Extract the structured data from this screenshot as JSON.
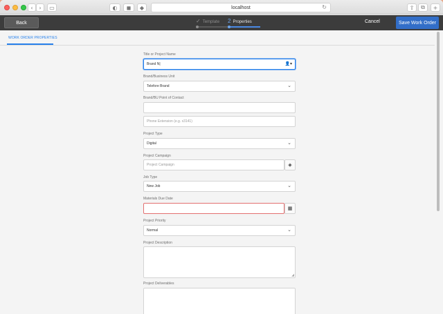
{
  "browser": {
    "url": "localhost"
  },
  "toolbar": {
    "back_label": "Back",
    "steps": [
      {
        "number": "",
        "label": "Template",
        "state": "done"
      },
      {
        "number": "2",
        "label": "Properties",
        "state": "active"
      }
    ],
    "cancel_label": "Cancel",
    "save_label": "Save Work Order"
  },
  "tab": {
    "label": "WORK ORDER PROPERTIES"
  },
  "form": {
    "title": {
      "label": "Title or Project Name",
      "value": "Brand N|"
    },
    "brand_unit": {
      "label": "Brand/Business Unit",
      "value": "Telefore Brand"
    },
    "contact": {
      "label": "Brand/BU Point of Contact",
      "value": ""
    },
    "phone": {
      "placeholder": "Phone Extension (e.g. x3141)"
    },
    "project_type": {
      "label": "Project Type",
      "value": "Digital"
    },
    "campaign": {
      "label": "Project Campaign",
      "placeholder": "Project Campaign"
    },
    "job_type": {
      "label": "Job Type",
      "value": "New Job"
    },
    "due_date": {
      "label": "Materials Due Date",
      "value": ""
    },
    "priority": {
      "label": "Project Priority",
      "value": "Normal"
    },
    "description": {
      "label": "Project Description"
    },
    "deliverables": {
      "label": "Project Deliverables"
    }
  },
  "icons": {
    "checkmark": "checkmark-icon",
    "user_picker": "user-icon",
    "campaign_picker": "stack-icon",
    "calendar": "calendar-icon",
    "chevron": "chevron-down-icon"
  },
  "colors": {
    "accent": "#2680eb",
    "save_button": "#326ec8",
    "toolbar": "#3c3c3c",
    "error_border": "#e36f6f"
  }
}
